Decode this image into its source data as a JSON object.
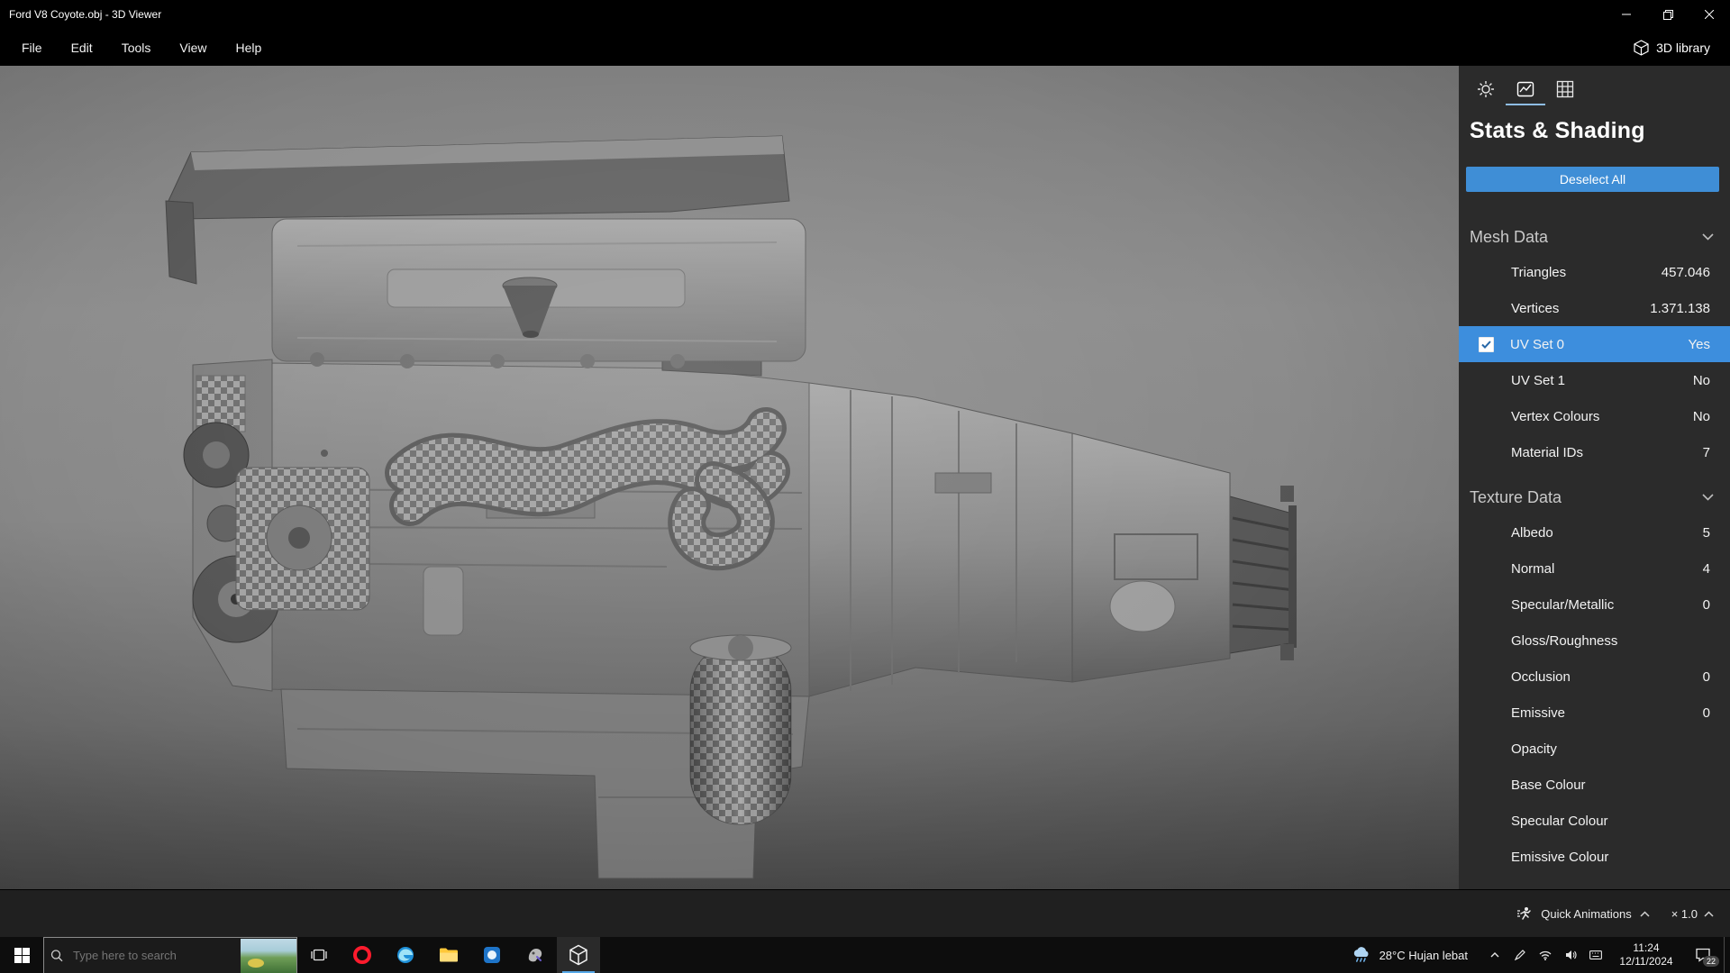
{
  "window": {
    "title": "Ford V8 Coyote.obj - 3D Viewer"
  },
  "menu": {
    "items": [
      "File",
      "Edit",
      "Tools",
      "View",
      "Help"
    ],
    "library_label": "3D library"
  },
  "panel": {
    "tabs": [
      "environment",
      "stats-shading",
      "grid-views"
    ],
    "active_tab_index": 1,
    "title": "Stats & Shading",
    "deselect_label": "Deselect All",
    "mesh": {
      "title": "Mesh Data",
      "rows": [
        {
          "label": "Triangles",
          "value": "457.046"
        },
        {
          "label": "Vertices",
          "value": "1.371.138"
        },
        {
          "label": "UV Set 0",
          "value": "Yes",
          "selected": true,
          "checked": true
        },
        {
          "label": "UV Set 1",
          "value": "No"
        },
        {
          "label": "Vertex Colours",
          "value": "No"
        },
        {
          "label": "Material IDs",
          "value": "7"
        }
      ]
    },
    "texture": {
      "title": "Texture Data",
      "rows": [
        {
          "label": "Albedo",
          "value": "5"
        },
        {
          "label": "Normal",
          "value": "4"
        },
        {
          "label": "Specular/Metallic",
          "value": "0"
        },
        {
          "label": "Gloss/Roughness",
          "value": ""
        },
        {
          "label": "Occlusion",
          "value": "0"
        },
        {
          "label": "Emissive",
          "value": "0"
        },
        {
          "label": "Opacity",
          "value": ""
        },
        {
          "label": "Base Colour",
          "value": ""
        },
        {
          "label": "Specular Colour",
          "value": ""
        },
        {
          "label": "Emissive Colour",
          "value": ""
        }
      ]
    }
  },
  "bottom_bar": {
    "quick_animations_label": "Quick Animations",
    "speed_label": "× 1.0"
  },
  "taskbar": {
    "search_placeholder": "Type here to search",
    "weather": "28°C Hujan lebat",
    "clock": {
      "time": "11:24",
      "date": "12/11/2024"
    },
    "notification_count": "22"
  },
  "model": {
    "name": "Ford V8 Coyote engine"
  },
  "colors": {
    "accent": "#3f8ed6",
    "selection": "#3d8edd",
    "panel-bg": "#2b2b2b",
    "taskbar-bg": "#0d0d0d",
    "titlebar-bg": "#000000"
  }
}
